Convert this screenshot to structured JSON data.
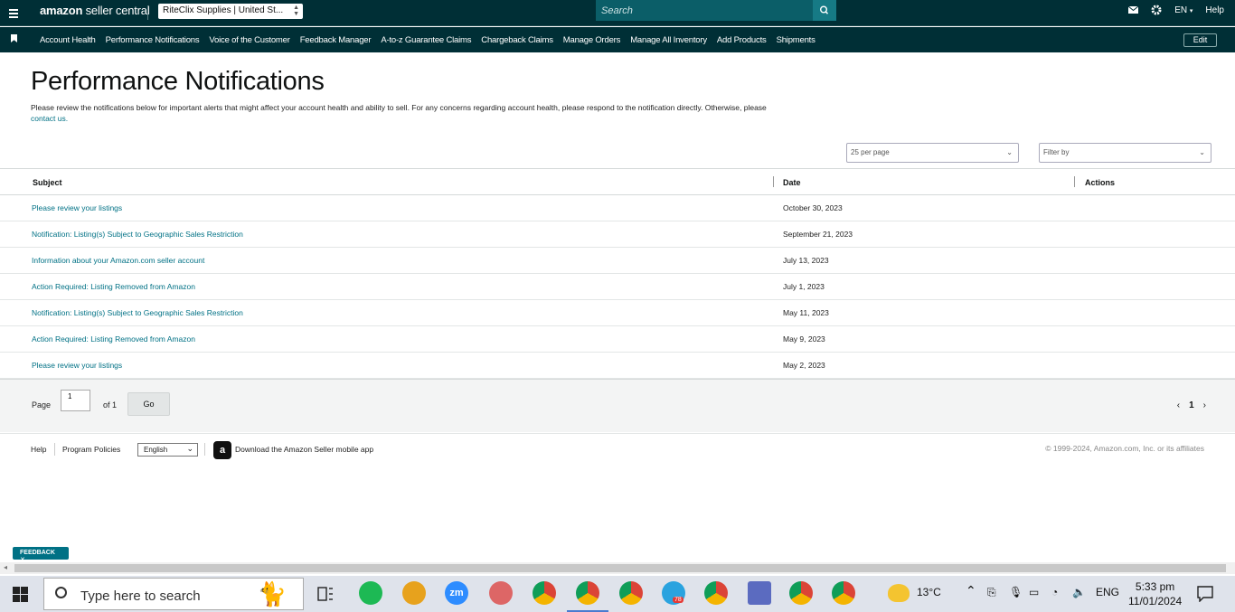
{
  "topbar": {
    "logo_prefix": "amazon",
    "logo_suffix": "seller central",
    "store": "RiteClix Supplies | United St...",
    "search_placeholder": "Search",
    "language": "EN",
    "help": "Help"
  },
  "nav": {
    "items": [
      "Account Health",
      "Performance Notifications",
      "Voice of the Customer",
      "Feedback Manager",
      "A-to-z Guarantee Claims",
      "Chargeback Claims",
      "Manage Orders",
      "Manage All Inventory",
      "Add Products",
      "Shipments"
    ],
    "edit": "Edit"
  },
  "page": {
    "title": "Performance Notifications",
    "intro": "Please review the notifications below for important alerts that might affect your account health and ability to sell. For any concerns regarding account health, please respond to the notification directly. Otherwise, please",
    "contact_link": "contact us.",
    "per_page": "25 per page",
    "filter_placeholder": "Filter by"
  },
  "table": {
    "headers": {
      "subject": "Subject",
      "date": "Date",
      "actions": "Actions"
    },
    "rows": [
      {
        "subject": "Please review your listings",
        "date": "October 30, 2023"
      },
      {
        "subject": "Notification: Listing(s) Subject to Geographic Sales Restriction",
        "date": "September 21, 2023"
      },
      {
        "subject": "Information about your Amazon.com seller account",
        "date": "July 13, 2023"
      },
      {
        "subject": "Action Required: Listing Removed from Amazon",
        "date": "July 1, 2023"
      },
      {
        "subject": "Notification: Listing(s) Subject to Geographic Sales Restriction",
        "date": "May 11, 2023"
      },
      {
        "subject": "Action Required: Listing Removed from Amazon",
        "date": "May 9, 2023"
      },
      {
        "subject": "Please review your listings",
        "date": "May 2, 2023"
      }
    ]
  },
  "pager": {
    "page_label": "Page",
    "page_value": "1",
    "of_label": "of 1",
    "go": "Go",
    "prev": "‹",
    "current": "1",
    "next": "›"
  },
  "footer": {
    "help": "Help",
    "policies": "Program Policies",
    "language": "English",
    "app_text": "Download the Amazon Seller mobile app",
    "app_icon_letter": "a",
    "copyright": "© 1999-2024, Amazon.com, Inc. or its affiliates"
  },
  "feedback": "FEEDBACK ✕",
  "taskbar": {
    "search_placeholder": "Type here to search",
    "weather": "13°C",
    "lang": "ENG",
    "time": "5:33 pm",
    "date": "11/01/2024",
    "telegram_badge": "78"
  },
  "colors": {
    "header_bg": "#002f36",
    "link": "#007185",
    "search_bg": "#0b5e68"
  }
}
